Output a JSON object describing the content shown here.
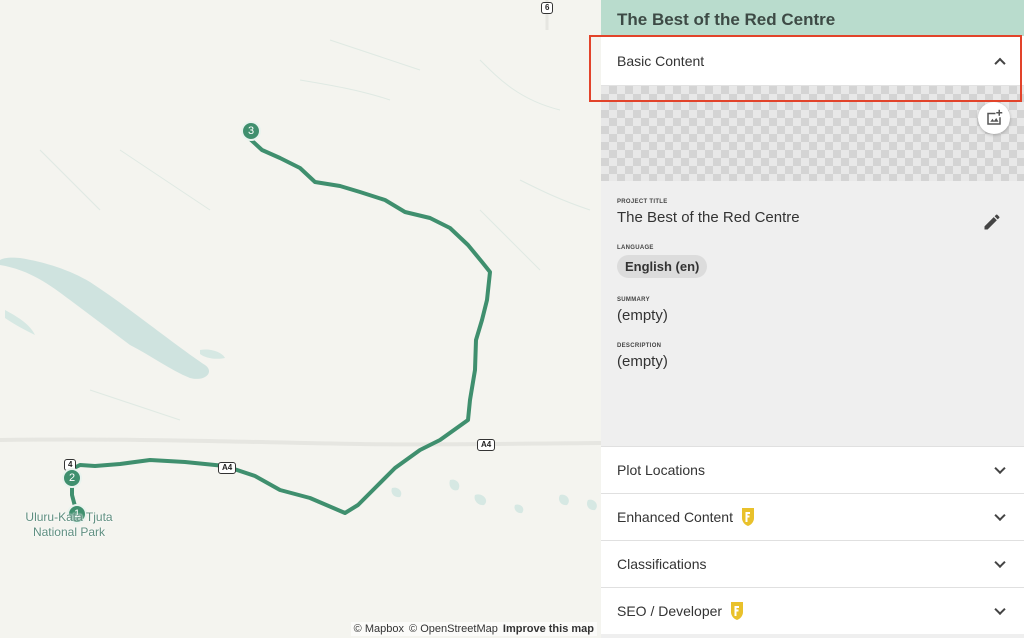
{
  "map": {
    "shields": [
      "6",
      "A4",
      "A4",
      "4"
    ],
    "markers": [
      "1",
      "2",
      "3"
    ],
    "park_label_line1": "Uluru-Kata Tjuta",
    "park_label_line2": "National Park",
    "attribution": {
      "mapbox": "© Mapbox",
      "osm": "© OpenStreetMap",
      "improve": "Improve this map"
    },
    "colors": {
      "route": "#3f8f6e",
      "water": "#cfe3df",
      "land": "#f4f4ef"
    }
  },
  "panel": {
    "title": "The Best of the Red Centre",
    "basic_content": {
      "label": "Basic Content",
      "add_image_icon": "add-photo-icon",
      "fields": {
        "project_title_label": "PROJECT TITLE",
        "project_title_value": "The Best of the Red Centre",
        "language_label": "LANGUAGE",
        "language_value": "English (en)",
        "summary_label": "SUMMARY",
        "summary_value": "(empty)",
        "description_label": "DESCRIPTION",
        "description_value": "(empty)"
      }
    },
    "sections": {
      "plot_locations": "Plot Locations",
      "enhanced_content": "Enhanced Content",
      "classifications": "Classifications",
      "seo_developer": "SEO / Developer"
    },
    "colors": {
      "header_bg": "#b9dccd",
      "highlight": "#e2432a",
      "badge": "#e9c12b"
    }
  }
}
